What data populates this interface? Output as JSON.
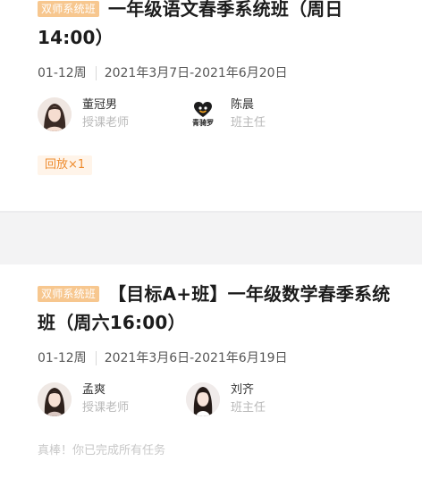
{
  "courses": [
    {
      "tag": "双师系统班",
      "title": "一年级语文春季系统班（周日14:00）",
      "months": "01-12周",
      "date_range": "2021年3月7日-2021年6月20日",
      "teacher": {
        "name": "董冠男",
        "role": "授课老师",
        "avatar_icon": "teacher-photo-icon"
      },
      "head": {
        "name": "陈晨",
        "role": "班主任",
        "avatar_icon": "brand-logo-icon",
        "logo_text": "青骑罗"
      },
      "badge": "回放×1"
    },
    {
      "tag": "双师系统班",
      "title": "【目标A+班】一年级数学春季系统班（周六16:00）",
      "months": "01-12周",
      "date_range": "2021年3月6日-2021年6月19日",
      "teacher": {
        "name": "孟爽",
        "role": "授课老师",
        "avatar_icon": "teacher-photo-icon"
      },
      "head": {
        "name": "刘齐",
        "role": "班主任",
        "avatar_icon": "teacher-photo-icon"
      },
      "status": "真棒！你已完成所有任务"
    }
  ],
  "colors": {
    "tag_bg": "#f7c78f",
    "badge_text": "#ee8b2d",
    "badge_bg": "#fff4e9",
    "background": "#f3f3f4"
  }
}
